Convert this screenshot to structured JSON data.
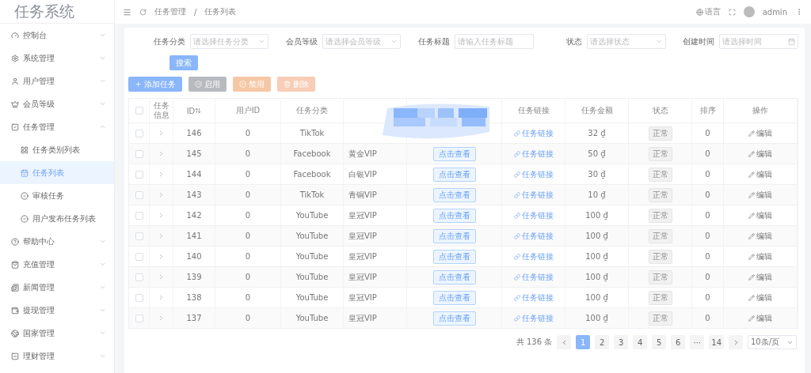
{
  "logo": "任务系统",
  "sidebar": {
    "items": [
      {
        "label": "控制台",
        "expanded": false
      },
      {
        "label": "系统管理",
        "expanded": false
      },
      {
        "label": "用户管理",
        "expanded": false
      },
      {
        "label": "会员等级",
        "expanded": false
      },
      {
        "label": "任务管理",
        "expanded": true,
        "children": [
          {
            "label": "任务类别列表",
            "selected": false
          },
          {
            "label": "任务列表",
            "selected": true
          },
          {
            "label": "审核任务",
            "selected": false
          },
          {
            "label": "用户发布任务列表",
            "selected": false
          }
        ]
      },
      {
        "label": "帮助中心",
        "expanded": false
      },
      {
        "label": "充值管理",
        "expanded": false
      },
      {
        "label": "新闻管理",
        "expanded": false
      },
      {
        "label": "提现管理",
        "expanded": false
      },
      {
        "label": "国家管理",
        "expanded": false
      },
      {
        "label": "理财管理",
        "expanded": false
      }
    ]
  },
  "header": {
    "breadcrumb": [
      "任务管理",
      "任务列表"
    ],
    "separator": "/",
    "language": "语言",
    "user": "admin"
  },
  "filters": [
    {
      "label": "任务分类",
      "kind": "select",
      "placeholder": "请选择任务分类"
    },
    {
      "label": "会员等级",
      "kind": "select",
      "placeholder": "请选择会员等级"
    },
    {
      "label": "任务标题",
      "kind": "input",
      "placeholder": "请输入任务标题"
    },
    {
      "label": "状态",
      "kind": "select",
      "placeholder": "请选择状态"
    },
    {
      "label": "创建时间",
      "kind": "date",
      "placeholder": "请选择时间"
    }
  ],
  "search_button": "搜索",
  "actions": [
    {
      "label": "添加任务",
      "kind": "primary"
    },
    {
      "label": "启用",
      "kind": "gray"
    },
    {
      "label": "禁用",
      "kind": "warn"
    },
    {
      "label": "删除",
      "kind": "danger"
    }
  ],
  "table": {
    "all_checked": false,
    "columns": [
      "任务信息",
      "ID",
      "用户ID",
      "任务分类",
      null,
      null,
      "任务链接",
      "任务金额",
      "状态",
      "排序",
      "操作"
    ],
    "rows": [
      {
        "checked": false,
        "id": "146",
        "user": "0",
        "category": "TikTok",
        "level": null,
        "view": null,
        "link": "任务链接",
        "amount": "32 ₫",
        "status": "正常",
        "sort": "0",
        "op": "编辑"
      },
      {
        "checked": false,
        "id": "145",
        "user": "0",
        "category": "Facebook",
        "level": "黄金VIP",
        "view": "点击查看",
        "link": "任务链接",
        "amount": "50 ₫",
        "status": "正常",
        "sort": "0",
        "op": "编辑"
      },
      {
        "checked": false,
        "id": "144",
        "user": "0",
        "category": "Facebook",
        "level": "白银VIP",
        "view": "点击查看",
        "link": "任务链接",
        "amount": "30 ₫",
        "status": "正常",
        "sort": "0",
        "op": "编辑"
      },
      {
        "checked": false,
        "id": "143",
        "user": "0",
        "category": "TikTok",
        "level": "青铜VIP",
        "view": "点击查看",
        "link": "任务链接",
        "amount": "10 ₫",
        "status": "正常",
        "sort": "0",
        "op": "编辑"
      },
      {
        "checked": false,
        "id": "142",
        "user": "0",
        "category": "YouTube",
        "level": "皇冠VIP",
        "view": "点击查看",
        "link": "任务链接",
        "amount": "100 ₫",
        "status": "正常",
        "sort": "0",
        "op": "编辑"
      },
      {
        "checked": false,
        "id": "141",
        "user": "0",
        "category": "YouTube",
        "level": "皇冠VIP",
        "view": "点击查看",
        "link": "任务链接",
        "amount": "100 ₫",
        "status": "正常",
        "sort": "0",
        "op": "编辑"
      },
      {
        "checked": false,
        "id": "140",
        "user": "0",
        "category": "YouTube",
        "level": "皇冠VIP",
        "view": "点击查看",
        "link": "任务链接",
        "amount": "100 ₫",
        "status": "正常",
        "sort": "0",
        "op": "编辑"
      },
      {
        "checked": false,
        "id": "139",
        "user": "0",
        "category": "YouTube",
        "level": "皇冠VIP",
        "view": "点击查看",
        "link": "任务链接",
        "amount": "100 ₫",
        "status": "正常",
        "sort": "0",
        "op": "编辑"
      },
      {
        "checked": false,
        "id": "138",
        "user": "0",
        "category": "YouTube",
        "level": "皇冠VIP",
        "view": "点击查看",
        "link": "任务链接",
        "amount": "100 ₫",
        "status": "正常",
        "sort": "0",
        "op": "编辑"
      },
      {
        "checked": false,
        "id": "137",
        "user": "0",
        "category": "YouTube",
        "level": "皇冠VIP",
        "view": "点击查看",
        "link": "任务链接",
        "amount": "100 ₫",
        "status": "正常",
        "sort": "0",
        "op": "编辑"
      }
    ]
  },
  "pagination": {
    "total": "共 136 条",
    "pages": [
      {
        "label": "1",
        "selected": true
      },
      {
        "label": "2",
        "selected": false
      },
      {
        "label": "3",
        "selected": false
      },
      {
        "label": "4",
        "selected": false
      },
      {
        "label": "5",
        "selected": false
      },
      {
        "label": "6",
        "selected": false
      },
      {
        "label": "···",
        "selected": false
      },
      {
        "label": "14",
        "selected": false
      }
    ],
    "page_size": "10条/页"
  }
}
